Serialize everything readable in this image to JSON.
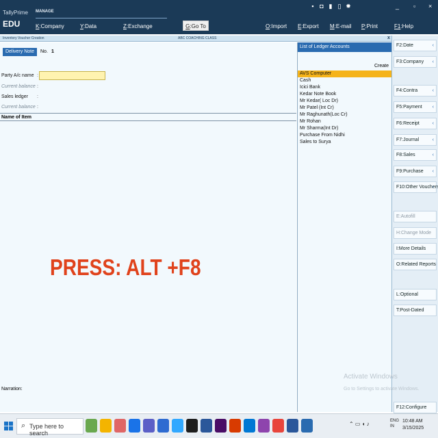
{
  "app": {
    "brand": "TallyPrime",
    "edition": "EDU",
    "section": "MANAGE"
  },
  "menu": [
    {
      "key": "K",
      "label": ":Company"
    },
    {
      "key": "Y",
      "label": ":Data"
    },
    {
      "key": "Z",
      "label": ":Exchange"
    },
    {
      "key": "G",
      "label": ":Go To"
    },
    {
      "key": "O",
      "label": ":Import"
    },
    {
      "key": "E",
      "label": ":Export"
    },
    {
      "key": "M",
      "label": ":E-mail"
    },
    {
      "key": "P",
      "label": ":Print"
    },
    {
      "key": "F1",
      "label": ":Help"
    }
  ],
  "window": {
    "title": "Inventory Voucher Creation",
    "company": "ABC COACHING CLASS",
    "close": "x",
    "minimize": "_",
    "restore": "▫",
    "close_app": "×"
  },
  "form": {
    "voucher_type": "Delivery Note",
    "no_label": "No.",
    "no_value": "1",
    "fields": [
      {
        "label": "Party A/c name",
        "dim": false
      },
      {
        "label": "Current balance",
        "dim": true
      },
      {
        "label": "Sales ledger",
        "dim": false
      },
      {
        "label": "Current balance",
        "dim": true
      }
    ],
    "party_value": "",
    "item_header": "Name of Item",
    "overlay": "PRESS: ALT +F8",
    "narration": "Narration:"
  },
  "ledger": {
    "title": "List of Ledger Accounts",
    "create": "Create",
    "items": [
      "AVS Computer",
      "Cash",
      "Icici Bank",
      "Kedar Note Book",
      "Mr Kedar( Loc Dr)",
      "Mr Patel (Int Cr)",
      "Mr Raghunath(Loc Cr)",
      "Mr Rohan",
      "Mr Sharma(Int Dr)",
      "Purchase From Nidhi",
      "Sales to Surya"
    ],
    "selected_index": 0
  },
  "right_buttons": [
    {
      "label": "F2:Date",
      "dim": false
    },
    {
      "label": "F3:Company",
      "dim": false
    },
    {
      "label": "F4:Contra",
      "dim": false
    },
    {
      "label": "F5:Payment",
      "dim": false
    },
    {
      "label": "F6:Receipt",
      "dim": false
    },
    {
      "label": "F7:Journal",
      "dim": false
    },
    {
      "label": "F8:Sales",
      "dim": false
    },
    {
      "label": "F9:Purchase",
      "dim": false
    },
    {
      "label": "F10:Other Vouchers",
      "dim": false
    },
    {
      "label": "E:Autofill",
      "dim": true
    },
    {
      "label": "H:Change Mode",
      "dim": true
    },
    {
      "label": "I:More Details",
      "dim": false
    },
    {
      "label": "O:Related Reports",
      "dim": false
    },
    {
      "label": "L:Optional",
      "dim": false
    },
    {
      "label": "T:Post-Dated",
      "dim": false
    },
    {
      "label": "F12:Configure",
      "dim": false
    }
  ],
  "watermark": {
    "line1": "Activate Windows",
    "line2": "Go to Settings to activate Windows."
  },
  "taskbar": {
    "search_placeholder": "Type here to search",
    "app_colors": [
      "#6aa84f",
      "#f4b400",
      "#e06666",
      "#1a73e8",
      "#5b5fc7",
      "#2e6bd1",
      "#31a8ff",
      "#1e1e1e",
      "#2b579a",
      "#4a0d66",
      "#d83b01",
      "#0078d4",
      "#8e44ad",
      "#e8453c",
      "#2b579a",
      "#2a6bb0"
    ],
    "lang": "ENG",
    "region": "IN",
    "time": "10:48 AM",
    "date": "3/15/2025"
  },
  "colors": {
    "accent": "#2a6bb0",
    "topbar": "#1b3a57",
    "selection": "#f5b31a",
    "overlay_text": "#e0421b"
  }
}
